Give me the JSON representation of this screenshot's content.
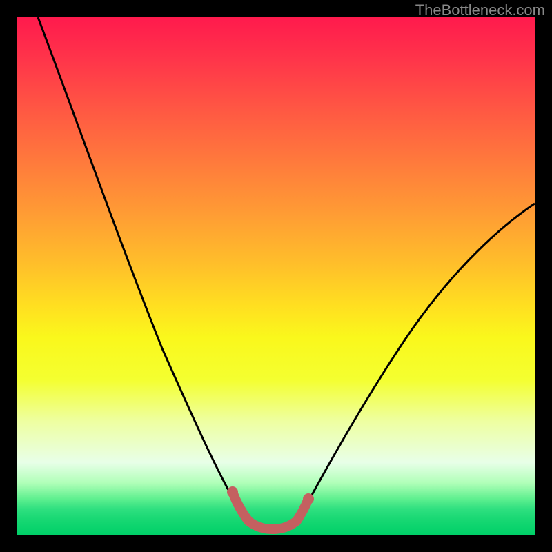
{
  "watermark": "TheBottleneck.com",
  "chart_data": {
    "type": "line",
    "title": "",
    "xlabel": "",
    "ylabel": "",
    "xlim": [
      0,
      100
    ],
    "ylim": [
      0,
      100
    ],
    "grid": false,
    "series": [
      {
        "name": "main-curve",
        "color": "#000000",
        "x": [
          4,
          8,
          12,
          16,
          20,
          24,
          28,
          32,
          36,
          38,
          40,
          42,
          44,
          46,
          48,
          50,
          52,
          54,
          58,
          64,
          72,
          80,
          88,
          96,
          100
        ],
        "y": [
          100,
          90,
          80,
          70,
          60,
          50,
          41,
          32,
          24,
          20,
          16,
          12,
          8,
          5,
          3,
          2,
          2,
          3,
          8,
          16,
          28,
          38,
          47,
          54,
          58
        ]
      },
      {
        "name": "bottom-highlight",
        "color": "#c46060",
        "x": [
          42,
          44,
          46,
          48,
          50,
          52,
          54
        ],
        "y": [
          9,
          4,
          2,
          2,
          2,
          2,
          6
        ]
      }
    ],
    "gradient_stops": [
      {
        "pct": 0,
        "color": "#ff1a4d"
      },
      {
        "pct": 50,
        "color": "#ffc800"
      },
      {
        "pct": 80,
        "color": "#f0ff80"
      },
      {
        "pct": 100,
        "color": "#00d068"
      }
    ]
  }
}
